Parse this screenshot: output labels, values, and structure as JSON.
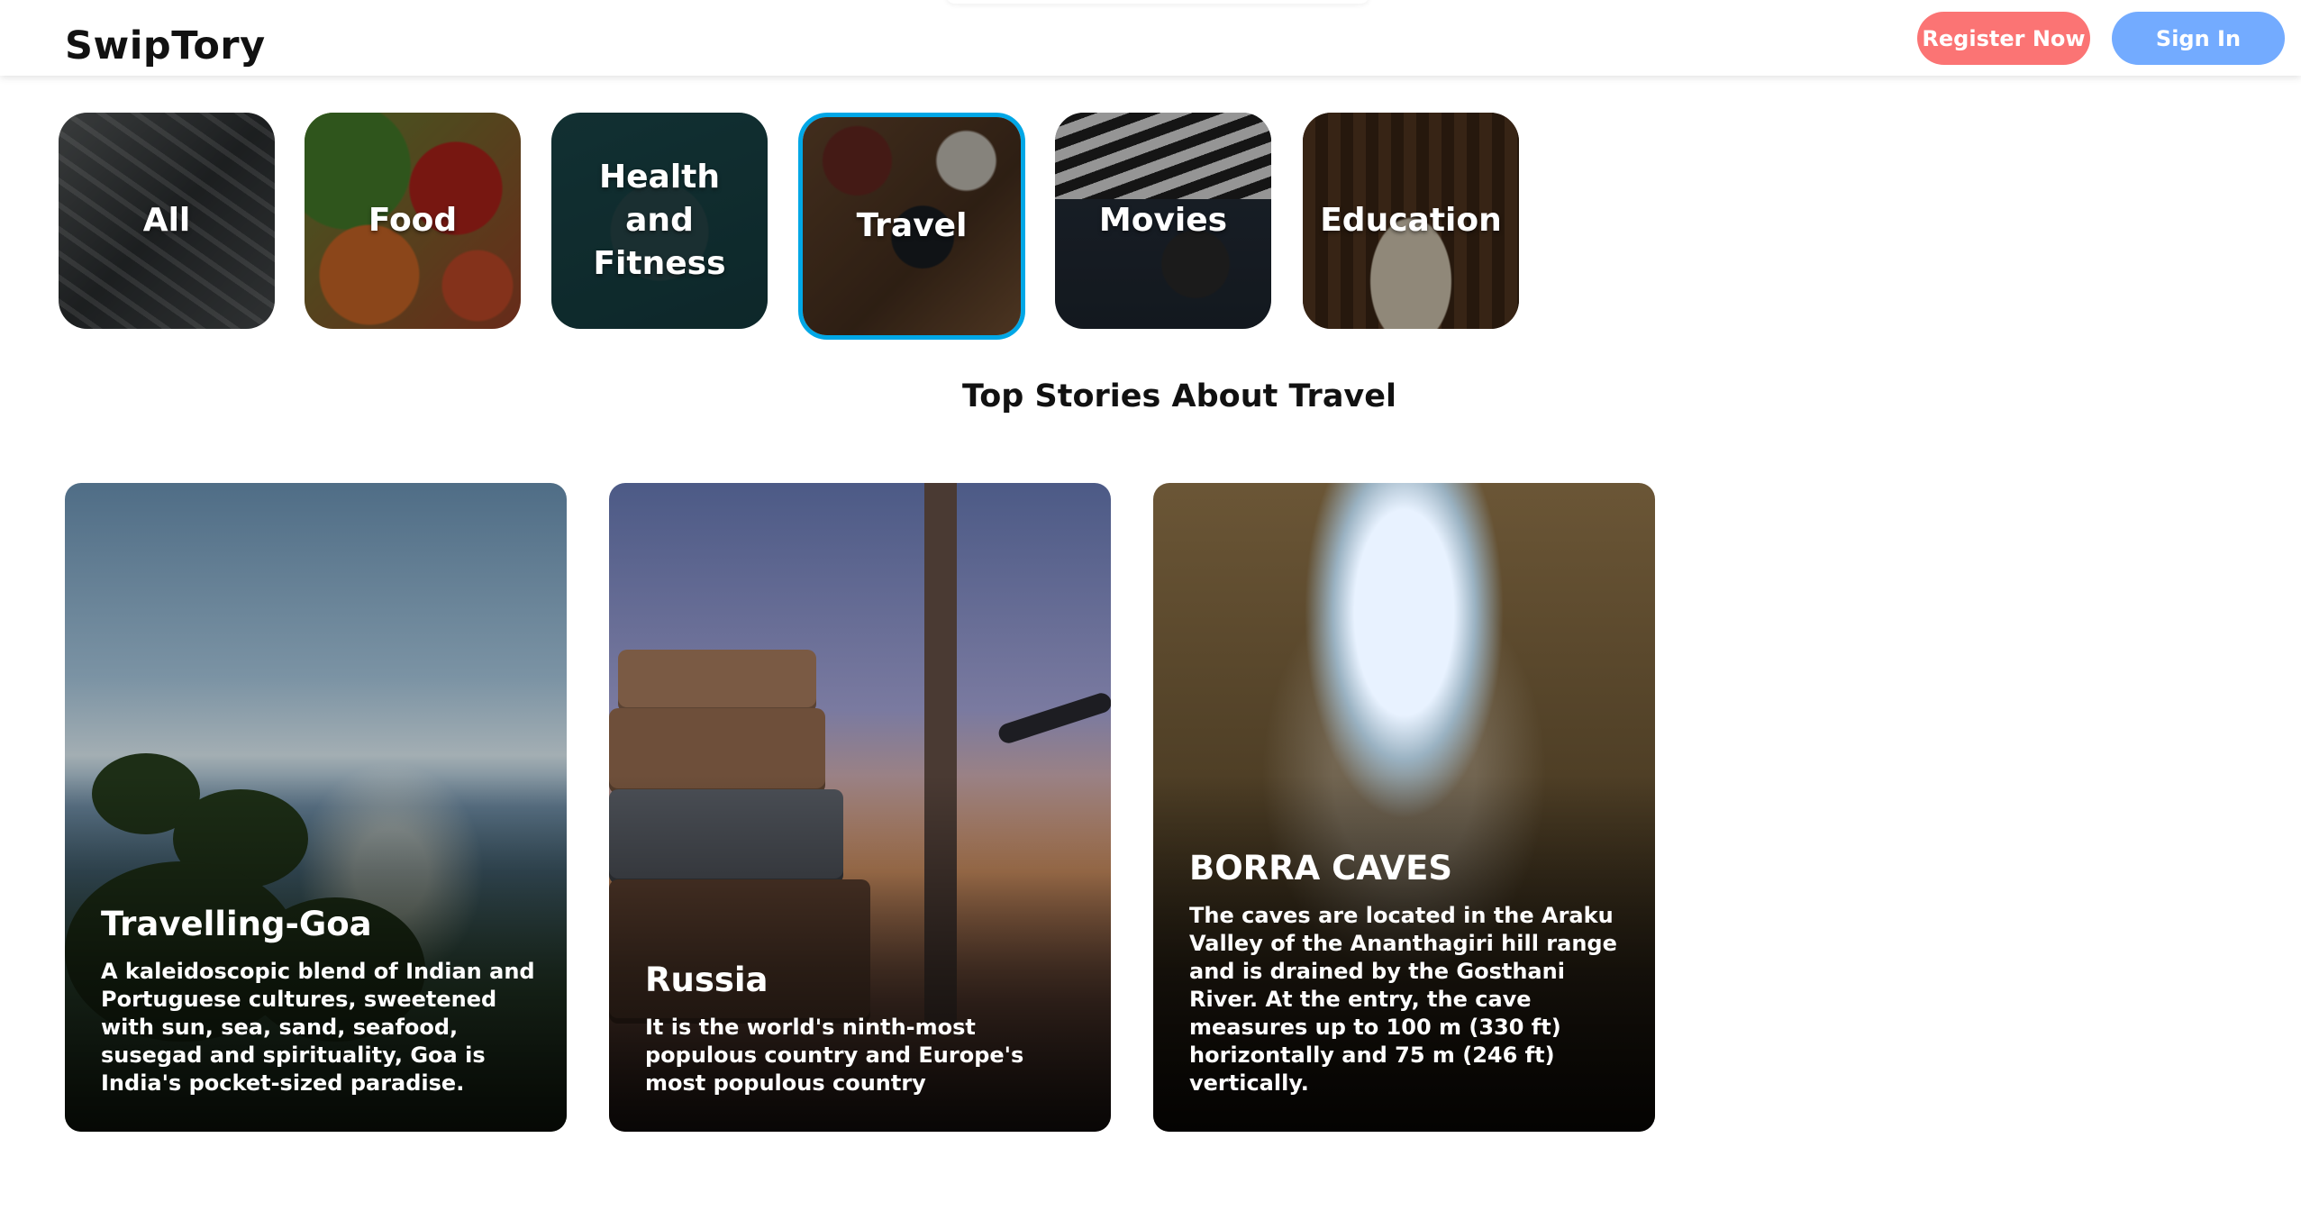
{
  "header": {
    "logo": "SwipTory",
    "register_label": "Register Now",
    "signin_label": "Sign In"
  },
  "categories": [
    {
      "label": "All",
      "selected": false
    },
    {
      "label": "Food",
      "selected": false
    },
    {
      "label": "Health and Fitness",
      "selected": false
    },
    {
      "label": "Travel",
      "selected": true
    },
    {
      "label": "Movies",
      "selected": false
    },
    {
      "label": "Education",
      "selected": false
    }
  ],
  "section": {
    "title": "Top Stories About Travel"
  },
  "stories": [
    {
      "title": "Travelling-Goa",
      "description": "A kaleidoscopic blend of Indian and Portuguese cultures, sweetened with sun, sea, sand, seafood, susegad and spirituality, Goa is India's pocket-sized paradise."
    },
    {
      "title": "Russia",
      "description": "It is the world's ninth-most populous country and Europe's most populous country"
    },
    {
      "title": "BORRA CAVES",
      "description": "The caves are located in the Araku Valley of the Ananthagiri hill range and is drained by the Gosthani River. At the entry, the cave measures up to 100 m (330 ft) horizontally and 75 m (246 ft) vertically."
    }
  ],
  "colors": {
    "register": "#fb7474",
    "signin": "#73abff",
    "selected_border": "#00a7e6"
  }
}
